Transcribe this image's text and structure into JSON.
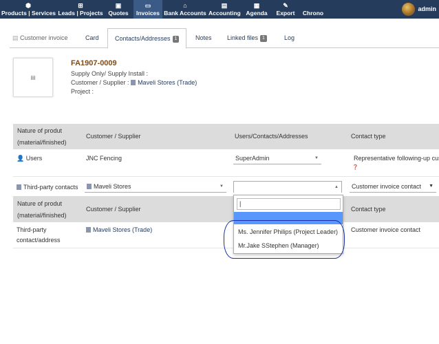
{
  "nav": {
    "items": [
      {
        "label": "Products | Services",
        "icon": "cube-icon"
      },
      {
        "label": "Leads | Projects",
        "icon": "sitemap-icon"
      },
      {
        "label": "Quotes",
        "icon": "briefcase-icon"
      },
      {
        "label": "Invoices",
        "icon": "money-icon"
      },
      {
        "label": "Bank Accounts",
        "icon": "bank-icon"
      },
      {
        "label": "Accounting",
        "icon": "calculator-icon"
      },
      {
        "label": "Agenda",
        "icon": "calendar-icon"
      },
      {
        "label": "Export",
        "icon": "wrench-icon"
      },
      {
        "label": "Chrono",
        "icon": ""
      }
    ],
    "user": "admin"
  },
  "tabs": {
    "customer_invoice": "Customer invoice",
    "card": "Card",
    "contacts": "Contacts/Addresses",
    "contacts_count": "1",
    "notes": "Notes",
    "linked_files": "Linked files",
    "linked_count": "1",
    "log": "Log"
  },
  "invoice": {
    "ref": "FA1907-0009",
    "supply_line": "Supply Only/ Supply Install :",
    "customer_label": "Customer / Supplier :",
    "customer_link": "Maveli Stores (Trade)",
    "project_label": "Project :"
  },
  "table": {
    "headers": [
      "Nature of produt (material/finished)",
      "Customer / Supplier",
      "Users/Contacts/Addresses",
      "Contact type"
    ],
    "users_row": {
      "nature": "Users",
      "company": "JNC Fencing",
      "contact": "SuperAdmin",
      "type": "Representative following-up cus"
    },
    "add_row": {
      "nature": "Third-party contacts",
      "company": "Maveli Stores",
      "contact": "",
      "type": "Customer invoice contact"
    },
    "headers2": [
      "Nature of produt (material/finished)",
      "Customer / Supplier",
      "",
      "Contact type"
    ],
    "third_row": {
      "nature_line1": "Third-party",
      "nature_line2": "contact/address",
      "company": "Maveli Stores (Trade)",
      "type": "Customer invoice contact"
    }
  },
  "dropdown": {
    "search_value": "|",
    "options": [
      "Ms. Jennifer Philips (Project Leader)",
      "Mr.Jake SStephen (Manager)"
    ]
  }
}
